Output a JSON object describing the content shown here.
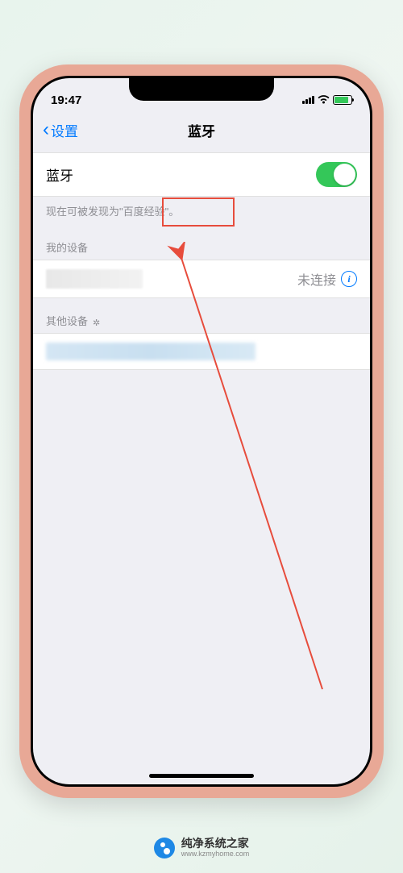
{
  "status": {
    "time": "19:47"
  },
  "nav": {
    "back_label": "设置",
    "title": "蓝牙"
  },
  "bluetooth": {
    "toggle_label": "蓝牙",
    "discoverable_text": "现在可被发现为\"百度经验\"。"
  },
  "sections": {
    "my_devices_header": "我的设备",
    "other_devices_header": "其他设备"
  },
  "devices": {
    "my_device_status": "未连接"
  },
  "watermark": {
    "main": "纯净系统之家",
    "sub": "www.kzmyhome.com"
  }
}
